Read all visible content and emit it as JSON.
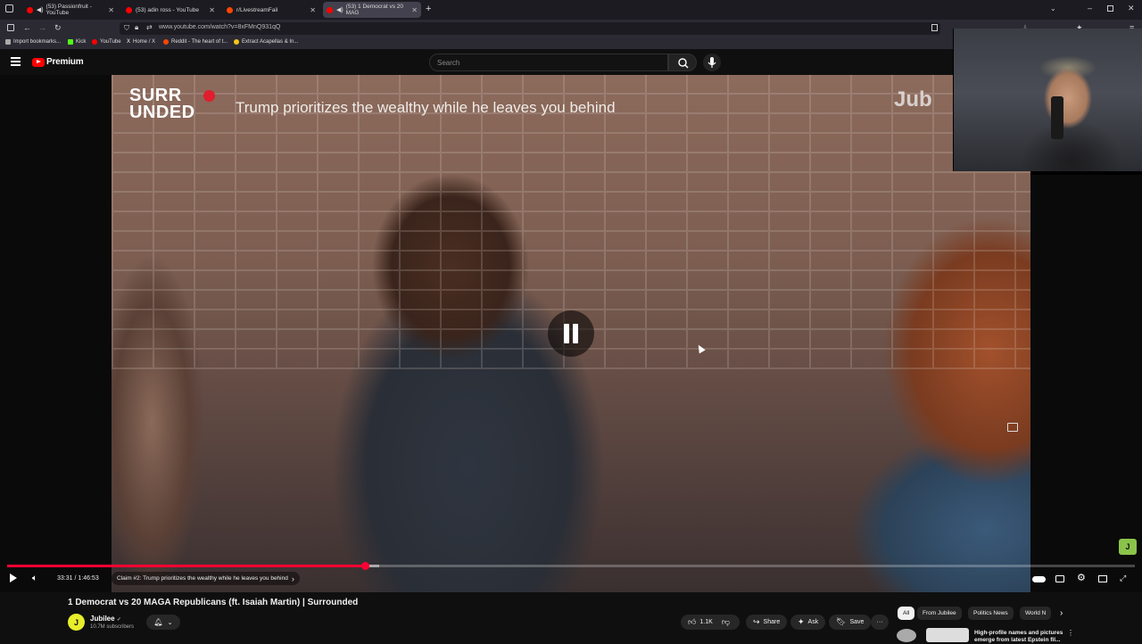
{
  "browser": {
    "tabs": [
      {
        "label": "(53) Passionfruit - YouTube",
        "favicon_color": "#ff0000",
        "audio": true
      },
      {
        "label": "(53) adin ross - YouTube",
        "favicon_color": "#ff0000",
        "audio": false
      },
      {
        "label": "r/LivestreamFail",
        "favicon_color": "#ff4500",
        "audio": false
      },
      {
        "label": "(53) 1 Democrat vs 20 MAG",
        "favicon_color": "#ff0000",
        "audio": true,
        "active": true
      }
    ],
    "new_tab": "+",
    "url": "www.youtube.com/watch?v=8xFMnQ931qQ",
    "bookmarks": [
      {
        "label": "Import bookmarks...",
        "color": "#aaaaaa"
      },
      {
        "label": "Kick",
        "color": "#53fc18"
      },
      {
        "label": "YouTube",
        "color": "#ff0000"
      },
      {
        "label": "Home / X",
        "color": "#ffffff"
      },
      {
        "label": "Reddit - The heart of t...",
        "color": "#ff4500"
      },
      {
        "label": "Extract Acapellas & In...",
        "color": "#f5c518"
      }
    ]
  },
  "youtube": {
    "logo_text": "Premium",
    "search_placeholder": "Search"
  },
  "video": {
    "overlay_show_logo": "SURR UNDED",
    "overlay_show_logo_line1": "SURR",
    "overlay_show_logo_line2": "UNDED",
    "overlay_claim": "Trump prioritizes the wealthy while he leaves you behind",
    "overlay_brand": "Jub",
    "progress_fraction": 0.318,
    "buffer_fraction": 0.33,
    "time": "33:31 / 1:46:53",
    "chapter": "Claim #2: Trump prioritizes the wealthy while he leaves you behind",
    "chapter_arrow": "›"
  },
  "below": {
    "title": "1 Democrat vs 20 MAGA Republicans (ft. Isaiah Martin) | Surrounded",
    "channel_avatar": "J",
    "channel_name": "Jubilee",
    "verified": "✓",
    "subscribers": "10.7M subscribers",
    "likes": "1.1K",
    "share": "Share",
    "ask": "Ask",
    "save": "Save",
    "more": "···",
    "chips": [
      "All",
      "From Jubilee",
      "Politics News",
      "World N"
    ],
    "suggestion_title": "High-profile names and pictures emerge from latest Epstein fil..."
  },
  "colors": {
    "accent": "#ff0033",
    "jubilee_yellow": "#e7ee2a"
  }
}
